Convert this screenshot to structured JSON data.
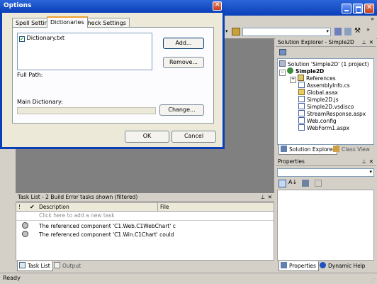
{
  "dialog": {
    "title": "Options",
    "tabs": [
      "Spell Settings",
      "Dictionaries",
      "Check Settings"
    ],
    "dictionary_item": "Dictionary.txt",
    "add_label": "Add...",
    "remove_label": "Remove...",
    "full_path_label": "Full Path:",
    "main_dictionary_label": "Main Dictionary:",
    "main_dictionary_value": "",
    "change_label": "Change...",
    "ok_label": "OK",
    "cancel_label": "Cancel"
  },
  "solution_explorer": {
    "title": "Solution Explorer - Simple2D",
    "items": [
      "Solution 'Simple2D' (1 project)",
      "Simple2D",
      "References",
      "AssemblyInfo.cs",
      "Global.asax",
      "Simple2D.js",
      "Simple2D.vsdisco",
      "StreamResponse.aspx",
      "Web.config",
      "WebForm1.aspx"
    ],
    "tab_solution": "Solution Explorer",
    "tab_class": "Class View"
  },
  "properties": {
    "title": "Properties",
    "tab_properties": "Properties",
    "tab_help": "Dynamic Help"
  },
  "tasklist": {
    "title": "Task List - 2 Build Error tasks shown (filtered)",
    "col_bang": "!",
    "col_description": "Description",
    "col_file": "File",
    "add_placeholder": "Click here to add a new task",
    "rows": [
      "The referenced component 'C1.Web.C1WebChart' c",
      "The referenced component 'C1.Win.C1Chart' could"
    ],
    "tab_tasklist": "Task List",
    "tab_output": "Output"
  },
  "status": {
    "text": "Ready"
  },
  "colors": {
    "title_blue": "#0a3fb8",
    "workspace_gray": "#808080",
    "dialog_bg": "#ece9d8"
  }
}
